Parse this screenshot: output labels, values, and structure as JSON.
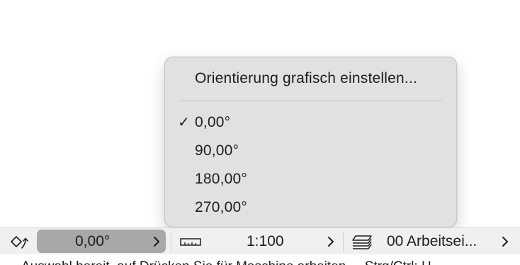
{
  "menu": {
    "title_item": "Orientierung grafisch einstellen...",
    "items": [
      {
        "label": "0,00°",
        "checked": true
      },
      {
        "label": "90,00°",
        "checked": false
      },
      {
        "label": "180,00°",
        "checked": false
      },
      {
        "label": "270,00°",
        "checked": false
      }
    ],
    "check_mark": "✓"
  },
  "toolbar": {
    "orientation_icon": "orientation-icon",
    "orientation_value": "0,00°",
    "scale_icon": "ruler-icon",
    "scale_value": "1:100",
    "layers_icon": "layers-icon",
    "layer_value": "00 Arbeitsei..."
  },
  "status": {
    "text": "Auswahl bereit, auf Drücken Sie für Maschine arbeiten ... Strg/Ctrl: H"
  },
  "colors": {
    "menu_bg": "#e3e1df",
    "active_field_bg": "#a9a8a7",
    "toolbar_bg": "#f1f0ef"
  }
}
